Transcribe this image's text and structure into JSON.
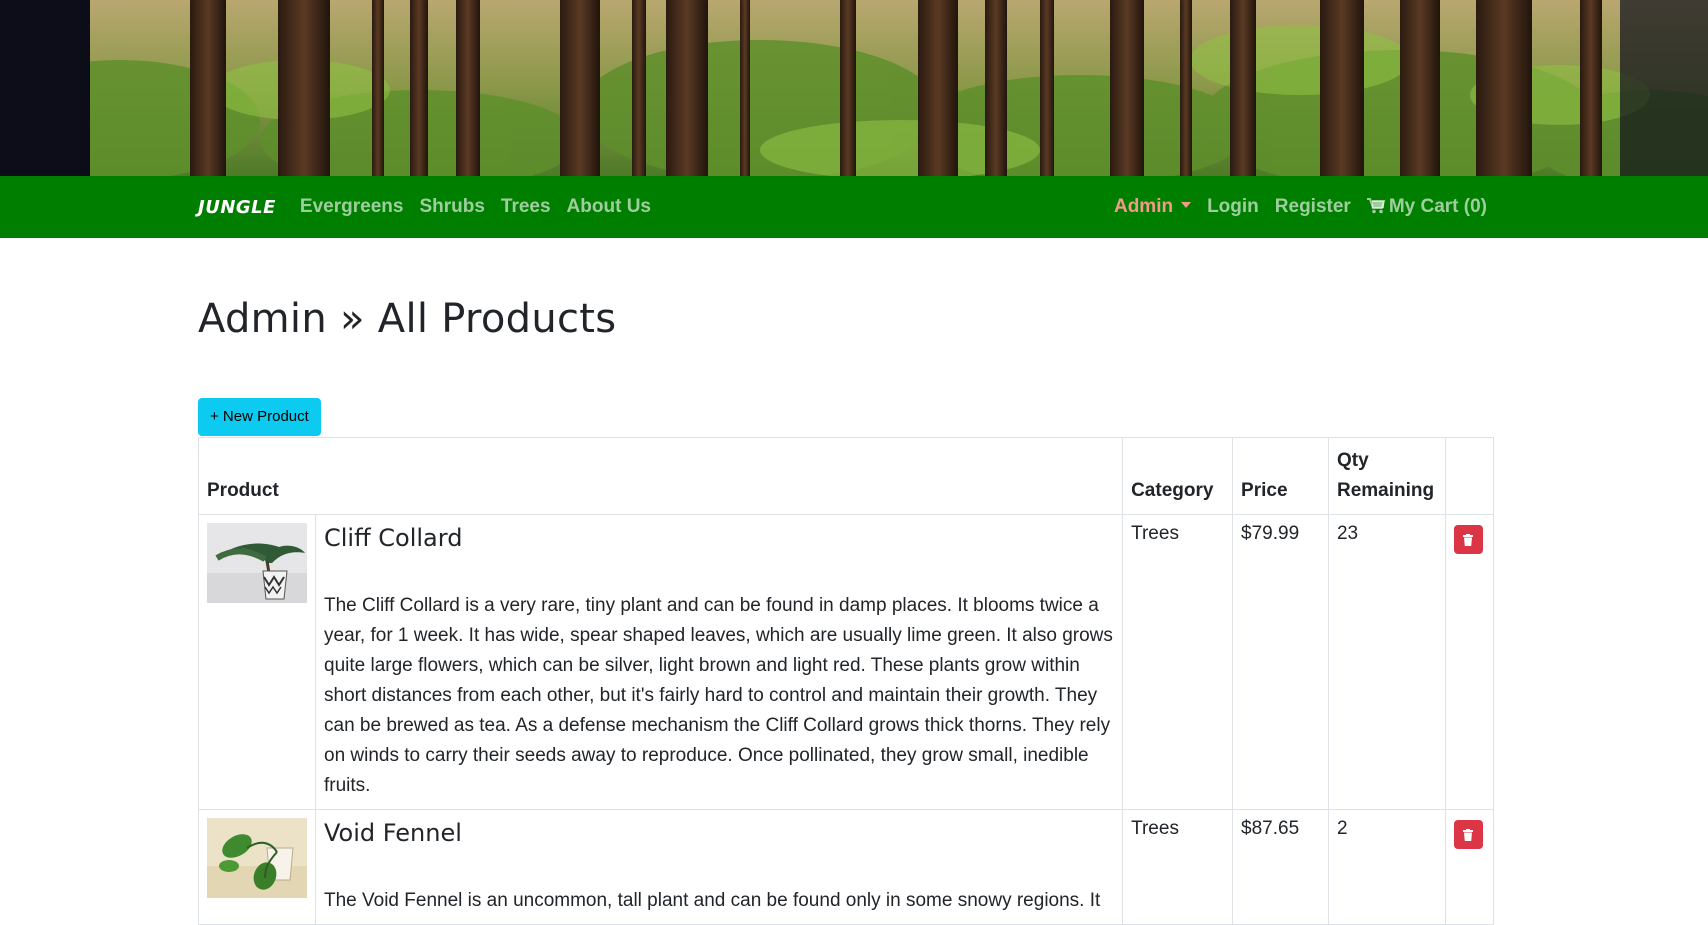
{
  "navbar": {
    "brand": "JUNGLE",
    "links": [
      "Evergreens",
      "Shrubs",
      "Trees",
      "About Us"
    ],
    "admin": "Admin",
    "login": "Login",
    "register": "Register",
    "cart": "My Cart (0)"
  },
  "page": {
    "title": "Admin » All Products",
    "new_product_label": "+ New Product"
  },
  "table": {
    "headers": {
      "product": "Product",
      "category": "Category",
      "price": "Price",
      "qty": "Qty Remaining"
    },
    "rows": [
      {
        "name": "Cliff Collard",
        "description": "The Cliff Collard is a very rare, tiny plant and can be found in damp places. It blooms twice a year, for 1 week. It has wide, spear shaped leaves, which are usually lime green. It also grows quite large flowers, which can be silver, light brown and light red. These plants grow within short distances from each other, but it's fairly hard to control and maintain their growth. They can be brewed as tea. As a defense mechanism the Cliff Collard grows thick thorns. They rely on winds to carry their seeds away to reproduce. Once pollinated, they grow small, inedible fruits.",
        "category": "Trees",
        "price": "$79.99",
        "qty": "23"
      },
      {
        "name": "Void Fennel",
        "description": "The Void Fennel is an uncommon, tall plant and can be found only in some snowy regions. It",
        "category": "Trees",
        "price": "$87.65",
        "qty": "2"
      }
    ]
  },
  "colors": {
    "navbar_bg": "#007e00",
    "admin_link": "#f49a8a",
    "new_button": "#0dcaf0",
    "delete_button": "#dc3545"
  },
  "icons": [
    "cart-icon",
    "caret-down-icon",
    "trash-icon"
  ]
}
